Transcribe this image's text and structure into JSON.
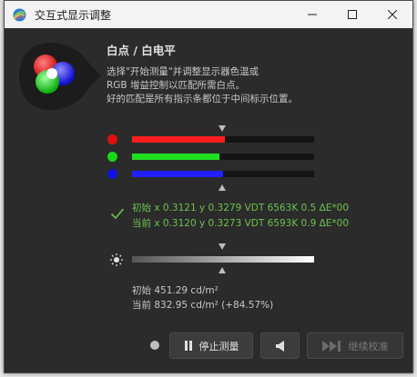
{
  "window": {
    "title": "交互式显示调整",
    "controls": {
      "minimize": "─",
      "maximize": "☐",
      "close": "✕"
    }
  },
  "header": {
    "heading": "白点 / 白电平",
    "description": [
      "选择\"开始测量\"并调整显示器色温或",
      "RGB 增益控制以匹配所需白点。",
      "好的匹配是所有指示条都位于中间标示位置。"
    ]
  },
  "rgb_bars": [
    {
      "channel": "red",
      "color": "#ff1f1f",
      "dot": "#e01010",
      "level": 0.51
    },
    {
      "channel": "green",
      "color": "#1fe01f",
      "dot": "#18d818",
      "level": 0.48
    },
    {
      "channel": "blue",
      "color": "#1f1fff",
      "dot": "#1010e8",
      "level": 0.5
    }
  ],
  "measurement": {
    "initial": "初始 x 0.3121 y 0.3279 VDT 6563K 0.5 ΔE*00",
    "current": "当前 x 0.3120 y 0.3273 VDT 6593K 0.9 ΔE*00",
    "color": "#6ec24e"
  },
  "luminance": {
    "initial": "初始 451.29 cd/m²",
    "current": "当前 832.95 cd/m² (+84.57%)"
  },
  "buttons": {
    "stop": "停止测量",
    "continue": "继续校准"
  },
  "icons": [
    "app-logo-icon",
    "check-icon",
    "sun-icon",
    "pause-icon",
    "speaker-icon",
    "skip-forward-icon"
  ]
}
